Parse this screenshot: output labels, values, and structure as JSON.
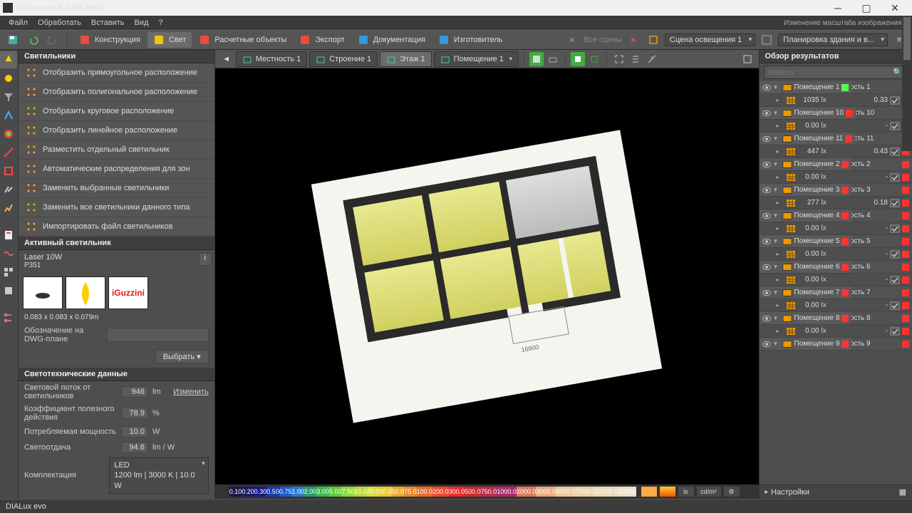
{
  "title": "DIALux evo 8.0 (64 бита)",
  "menu": [
    "Файл",
    "Обработать",
    "Вставить",
    "Вид",
    "?"
  ],
  "hint": "Изменение масштаба изображения >",
  "modes": [
    {
      "label": "Конструкция",
      "icon": "#e74c3c"
    },
    {
      "label": "Свет",
      "icon": "#f1c40f",
      "active": true
    },
    {
      "label": "Расчетные объекты",
      "icon": "#e74c3c"
    },
    {
      "label": "Экспорт",
      "icon": "#e74c3c"
    },
    {
      "label": "Документация",
      "icon": "#3498db"
    },
    {
      "label": "Изготовитель",
      "icon": "#3498db"
    }
  ],
  "scene_combo": "Сцена освещения 1",
  "layout_combo": "Планировка здания и в...",
  "nav": [
    {
      "label": "Местность 1"
    },
    {
      "label": "Строение 1"
    },
    {
      "label": "Этаж 1",
      "active": true
    },
    {
      "label": "Помещение 1",
      "dd": true
    }
  ],
  "leftpanel": {
    "header": "Светильники",
    "tools": [
      {
        "label": "Отобразить прямоугольное расположение"
      },
      {
        "label": "Отобразить полигональное расположение"
      },
      {
        "label": "Отобразить круговое расположение"
      },
      {
        "label": "Отобразить линейное расположение"
      },
      {
        "label": "Разместить отдельный светильник"
      },
      {
        "label": "Автоматические распределения для зон"
      },
      {
        "label": "Заменить выбранные светильники",
        "disabled": true
      },
      {
        "label": "Заменить все светильники данного типа"
      },
      {
        "label": "Импортировать файл светильников"
      }
    ],
    "active_header": "Активный светильник",
    "product": "Laser 10W",
    "code": "P351",
    "dims": "0.083 x 0.083 x 0.079m",
    "dwg_label": "Обозначение на DWG-плане",
    "choose": "Выбрать",
    "photodata_header": "Светотехнические данные",
    "rows": [
      {
        "label": "Световой поток от светильников",
        "val": "946",
        "unit": "lm",
        "link": "Изменить"
      },
      {
        "label": "Коэффициент полезного действия",
        "val": "78.9",
        "unit": "%"
      },
      {
        "label": "Потребляемая мощность",
        "val": "10.0",
        "unit": "W"
      },
      {
        "label": "Светоотдача",
        "val": "94.6",
        "unit": "lm / W",
        "ro": true
      }
    ],
    "config_label": "Комплектация",
    "config_val": "LED\n1200 lm  |  3000 K  |  10.0 W"
  },
  "results": {
    "header": "Обзор результатов",
    "search": "Найти",
    "rooms": [
      {
        "name": "Помещение 1",
        "sq": "#5f5",
        "plane": "Рабочая плоскость 1",
        "lx": "1035",
        "g": "0.33",
        "psq": "#5f5"
      },
      {
        "name": "Помещение 10",
        "sq": "#f33",
        "plane": "Рабочая плоскость 10",
        "lx": "0.00",
        "g": "-",
        "psq": "#f33"
      },
      {
        "name": "Помещение 11",
        "sq": "#f33",
        "plane": "Рабочая плоскость 11",
        "lx": "447",
        "g": "0.43",
        "psq": "#f33"
      },
      {
        "name": "Помещение 2",
        "sq": "#f33",
        "plane": "Рабочая плоскость 2",
        "lx": "0.00",
        "g": "-",
        "psq": "#f33"
      },
      {
        "name": "Помещение 3",
        "sq": "#f33",
        "plane": "Рабочая плоскость 3",
        "lx": "277",
        "g": "0.18",
        "psq": "#f33"
      },
      {
        "name": "Помещение 4",
        "sq": "#f33",
        "plane": "Рабочая плоскость 4",
        "lx": "0.00",
        "g": "-",
        "psq": "#f33"
      },
      {
        "name": "Помещение 5",
        "sq": "#f33",
        "plane": "Рабочая плоскость 5",
        "lx": "0.00",
        "g": "-",
        "psq": "#f33"
      },
      {
        "name": "Помещение 6",
        "sq": "#f33",
        "plane": "Рабочая плоскость 6",
        "lx": "0.00",
        "g": "-",
        "psq": "#f33"
      },
      {
        "name": "Помещение 7",
        "sq": "#f33",
        "plane": "Рабочая плоскость 7",
        "lx": "0.00",
        "g": "-",
        "psq": "#f33"
      },
      {
        "name": "Помещение 8",
        "sq": "#f33",
        "plane": "Рабочая плоскость 8",
        "lx": "0.00",
        "g": "-",
        "psq": "#f33"
      },
      {
        "name": "Помещение 9",
        "sq": "#f33",
        "plane": "Рабочая плоскость 9"
      }
    ],
    "settings": "Настройки"
  },
  "scale": [
    {
      "v": "0.10",
      "c": "#1a1a4a"
    },
    {
      "v": "0.20",
      "c": "#1a1a6a"
    },
    {
      "v": "0.30",
      "c": "#1a1a8a"
    },
    {
      "v": "0.50",
      "c": "#1a3aaa"
    },
    {
      "v": "0.75",
      "c": "#1a5aca"
    },
    {
      "v": "1.00",
      "c": "#2a7aca"
    },
    {
      "v": "2.00",
      "c": "#2a9a6a"
    },
    {
      "v": "3.00",
      "c": "#3aba4a"
    },
    {
      "v": "5.00",
      "c": "#5aca3a"
    },
    {
      "v": "7.50",
      "c": "#8ada3a"
    },
    {
      "v": "10.0",
      "c": "#bada3a"
    },
    {
      "v": "20.0",
      "c": "#dada3a"
    },
    {
      "v": "30.0",
      "c": "#eaca2a"
    },
    {
      "v": "50.0",
      "c": "#eaaa2a"
    },
    {
      "v": "75.0",
      "c": "#ea8a2a"
    },
    {
      "v": "100.0",
      "c": "#ea6a2a"
    },
    {
      "v": "200.0",
      "c": "#ea4a2a"
    },
    {
      "v": "300.0",
      "c": "#ea2a2a"
    },
    {
      "v": "500.0",
      "c": "#ca2a2a"
    },
    {
      "v": "750.0",
      "c": "#ba2a4a"
    },
    {
      "v": "1000.0",
      "c": "#aa2a6a"
    },
    {
      "v": "2000.0",
      "c": "#da7a5a"
    },
    {
      "v": "3000.0",
      "c": "#eaaa7a"
    },
    {
      "v": "5000.0",
      "c": "#eaca9a"
    },
    {
      "v": "7500.0",
      "c": "#ead0aa"
    },
    {
      "v": "10000.0",
      "c": "#ead8ba"
    },
    {
      "v": "15000",
      "c": "#eae0ca"
    }
  ],
  "scale_units": [
    "lx",
    "cd/m²"
  ],
  "status": "DIALux evo"
}
